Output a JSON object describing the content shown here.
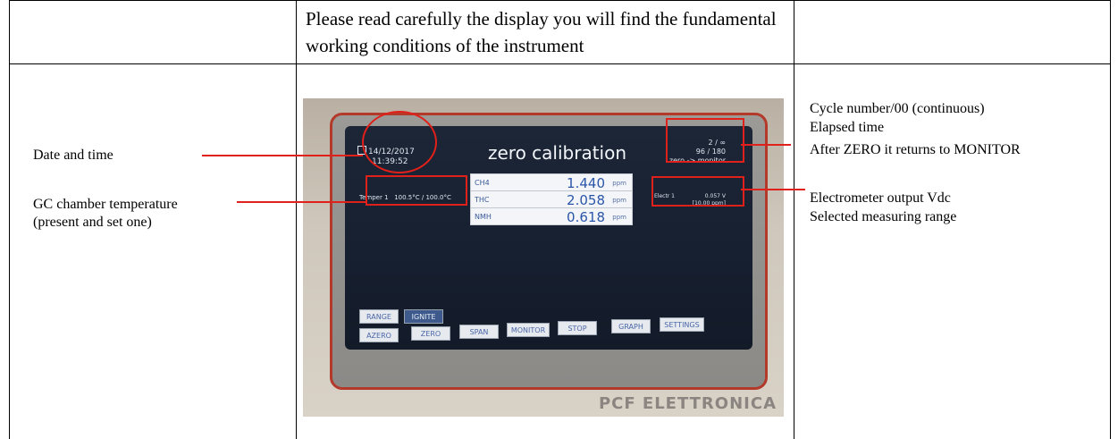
{
  "header": {
    "text": "Please read carefully the display you will find the fundamental working conditions of the instrument"
  },
  "annotations": {
    "date_time": "Date and time",
    "gc_temp_line1": "GC chamber temperature",
    "gc_temp_line2": "(present and set one)",
    "cycle_line1": "Cycle number/00 (continuous)",
    "cycle_line2": "Elapsed time",
    "cycle_line3": "After ZERO it returns to MONITOR",
    "electrometer_line1": "Electrometer output Vdc",
    "electrometer_line2": "Selected measuring range"
  },
  "screen": {
    "date": "14/12/2017",
    "time": "11:39:52",
    "title": "zero calibration",
    "cycle_line1": "2 / ∞",
    "cycle_line2": "96 / 180",
    "cycle_line3": "zero -> monitor",
    "temperature_label": "Temper 1",
    "temperature_value": "100.5°C / 100.0°C",
    "electrometer_label": "Electr 1",
    "electrometer_value": "0.057 V",
    "electrometer_range": "[10.00 ppm]",
    "measurements": [
      {
        "name": "CH4",
        "value": "1.440",
        "unit": "ppm"
      },
      {
        "name": "THC",
        "value": "2.058",
        "unit": "ppm"
      },
      {
        "name": "NMH",
        "value": "0.618",
        "unit": "ppm"
      }
    ],
    "buttons_row1": [
      "RANGE",
      "IGNITE"
    ],
    "buttons_row2": [
      "AZERO",
      "ZERO",
      "SPAN",
      "MONITOR",
      "STOP",
      "GRAPH",
      "SETTINGS"
    ]
  },
  "brand": "PCF ELETTRONICA"
}
